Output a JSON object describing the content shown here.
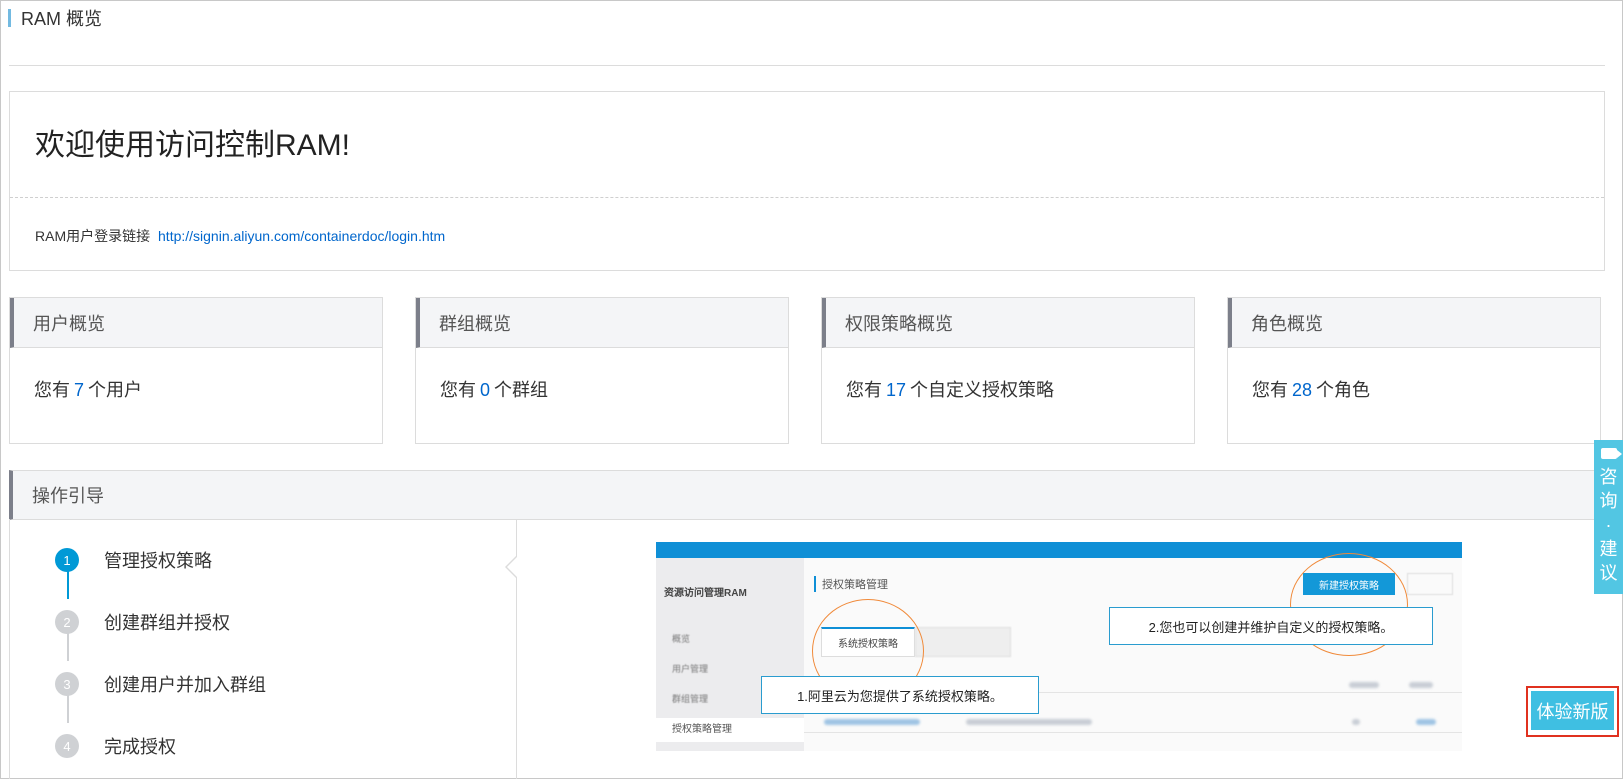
{
  "page": {
    "title": "RAM 概览"
  },
  "welcome": {
    "heading": "欢迎使用访问控制RAM!",
    "login_label": "RAM用户登录链接",
    "login_url": "http://signin.aliyun.com/containerdoc/login.htm"
  },
  "cards": [
    {
      "title": "用户概览",
      "prefix": "您有",
      "count": "7",
      "suffix": "个用户"
    },
    {
      "title": "群组概览",
      "prefix": "您有",
      "count": "0",
      "suffix": "个群组"
    },
    {
      "title": "权限策略概览",
      "prefix": "您有",
      "count": "17",
      "suffix": "个自定义授权策略"
    },
    {
      "title": "角色概览",
      "prefix": "您有",
      "count": "28",
      "suffix": "个角色"
    }
  ],
  "guide": {
    "title": "操作引导",
    "steps": [
      {
        "num": "1",
        "label": "管理授权策略"
      },
      {
        "num": "2",
        "label": "创建群组并授权"
      },
      {
        "num": "3",
        "label": "创建用户并加入群组"
      },
      {
        "num": "4",
        "label": "完成授权"
      }
    ],
    "illustration": {
      "app_name": "资源访问管理RAM",
      "nav": [
        "概览",
        "用户管理",
        "群组管理",
        "授权策略管理"
      ],
      "page_title": "授权策略管理",
      "new_button": "新建授权策略",
      "tab_system": "系统授权策略",
      "callout_1": "1.阿里云为您提供了系统授权策略。",
      "callout_2": "2.您也可以创建并维护自定义的授权策略。"
    }
  },
  "floating": {
    "consult": [
      "咨",
      "询",
      "·",
      "建",
      "议"
    ],
    "new_version": "体验新版"
  },
  "colors": {
    "accent": "#0099d6",
    "link": "#0066cc",
    "float_bg": "#52c6e3",
    "highlight_border": "#e0311f"
  }
}
